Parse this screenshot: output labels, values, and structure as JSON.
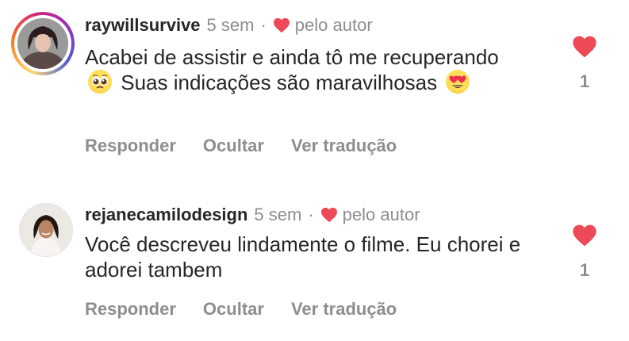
{
  "comments": [
    {
      "username": "raywillsurvive",
      "time": "5 sem",
      "separator": "·",
      "liked_by_author": "pelo autor",
      "text_parts": [
        "Acabei de assistir e ainda tô me recuperando",
        "Suas indicações são maravilhosas"
      ],
      "emojis": [
        "pleading-face-emoji",
        "heart-eyes-emoji"
      ],
      "actions": {
        "reply": "Responder",
        "hide": "Ocultar",
        "translate": "Ver tradução"
      },
      "likes": "1"
    },
    {
      "username": "rejanecamilodesign",
      "time": "5 sem",
      "separator": "·",
      "liked_by_author": "pelo autor",
      "text": "Você descreveu lindamente o filme. Eu chorei e adorei tambem",
      "actions": {
        "reply": "Responder",
        "hide": "Ocultar",
        "translate": "Ver tradução"
      },
      "likes": "1"
    }
  ],
  "colors": {
    "heart": "#ed4956",
    "muted": "#8e8e8e",
    "text": "#262626"
  },
  "icons": [
    "heart-icon",
    "avatar"
  ]
}
